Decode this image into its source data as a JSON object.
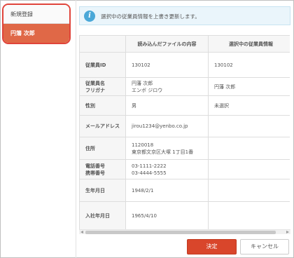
{
  "sidebar": {
    "items": [
      {
        "label": "新規登録"
      },
      {
        "label": "円藩 次郎"
      }
    ]
  },
  "info": {
    "icon": "info-icon",
    "message": "選択中の従業員情報を上書き更新します。"
  },
  "table": {
    "headers": [
      "",
      "読み込んだファイルの内容",
      "選択中の従業員情報"
    ],
    "rows": [
      {
        "label": [
          "従業員ID"
        ],
        "file": [
          "130102"
        ],
        "current": [
          "130102"
        ]
      },
      {
        "label": [
          "従業員名",
          "フリガナ"
        ],
        "file": [
          "円藩 次郎",
          "エンボ ジロウ"
        ],
        "current": [
          "円藩 次郎"
        ]
      },
      {
        "label": [
          "性別"
        ],
        "file": [
          "男"
        ],
        "current": [
          "未選択"
        ]
      },
      {
        "label": [
          "メールアドレス"
        ],
        "file": [
          "jirou1234@yenbo.co.jp"
        ],
        "current": [
          ""
        ]
      },
      {
        "label": [
          "住所"
        ],
        "file": [
          "1120018",
          "東京都文京区大塚 1丁目1番"
        ],
        "current": [
          ""
        ]
      },
      {
        "label": [
          "電話番号",
          "携帯番号"
        ],
        "file": [
          "03-1111-2222",
          "03-4444-5555"
        ],
        "current": [
          ""
        ]
      },
      {
        "label": [
          "生年月日"
        ],
        "file": [
          "1948/2/1"
        ],
        "current": [
          ""
        ]
      },
      {
        "label": [
          "入社年月日"
        ],
        "file": [
          "1965/4/10"
        ],
        "current": [
          ""
        ]
      }
    ]
  },
  "buttons": {
    "ok": "決定",
    "cancel": "キャンセル"
  },
  "colors": {
    "accent": "#d9462b",
    "highlight_border": "#e0443a",
    "info_bg": "#eaf5fb"
  }
}
